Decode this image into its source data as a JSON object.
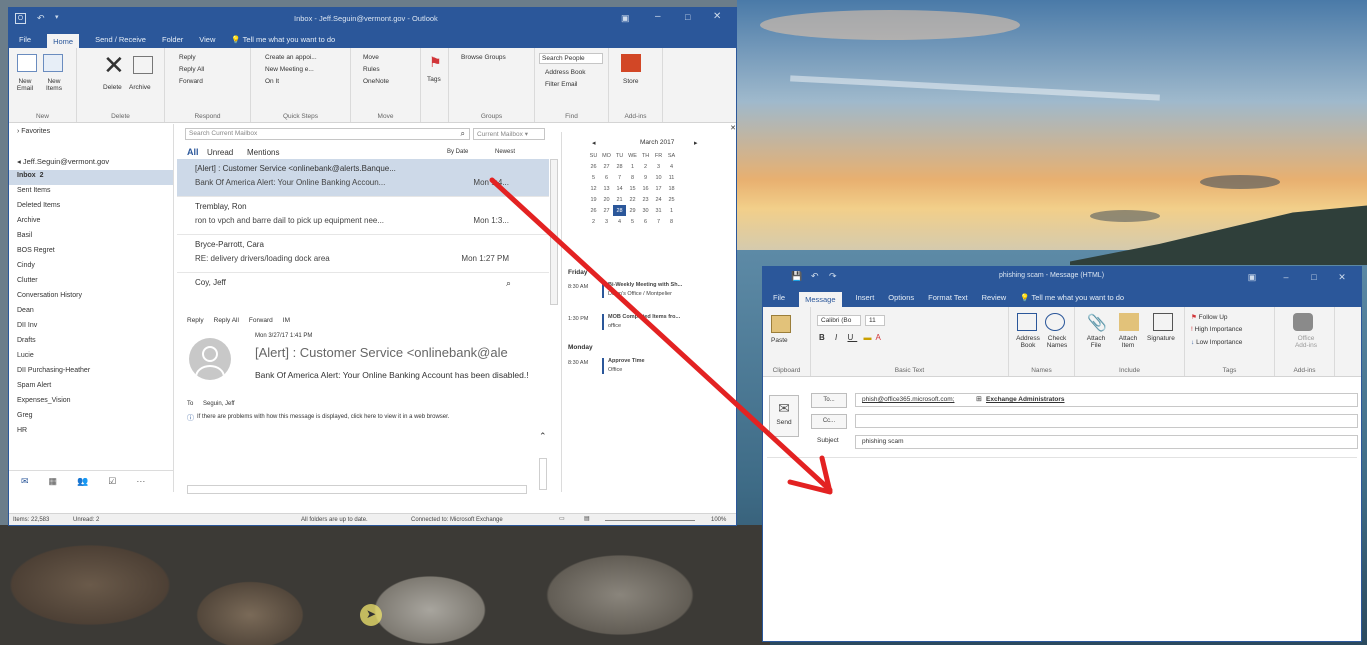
{
  "outlook": {
    "title": "Inbox - Jeff.Seguin@vermont.gov - Outlook",
    "tabs": [
      "File",
      "Home",
      "Send / Receive",
      "Folder",
      "View"
    ],
    "tell_me": "Tell me what you want to do",
    "ribbon": {
      "new_email": "New Email",
      "new_items": "New Items",
      "delete": "Delete",
      "archive": "Archive",
      "reply": "Reply",
      "reply_all": "Reply All",
      "forward": "Forward",
      "create_appt": "Create an appoi...",
      "new_meeting": "New Meeting e...",
      "on_it": "On It",
      "move": "Move",
      "rules": "Rules",
      "onenote": "OneNote",
      "tags": "Tags",
      "browse_groups": "Browse Groups",
      "search_people": "Search People",
      "address_book": "Address Book",
      "filter_email": "Filter Email",
      "store": "Store",
      "group_new": "New",
      "group_delete": "Delete",
      "group_respond": "Respond",
      "group_quicksteps": "Quick Steps",
      "group_move": "Move",
      "group_groups": "Groups",
      "group_find": "Find",
      "group_addins": "Add-ins"
    },
    "favorites": "Favorites",
    "account": "Jeff.Seguin@vermont.gov",
    "folders": [
      {
        "name": "Inbox",
        "count": "2"
      },
      {
        "name": "Sent Items"
      },
      {
        "name": "Deleted Items"
      },
      {
        "name": "Archive"
      },
      {
        "name": "Basil"
      },
      {
        "name": "BOS Regret"
      },
      {
        "name": "Cindy"
      },
      {
        "name": "Clutter"
      },
      {
        "name": "Conversation History"
      },
      {
        "name": "Dean"
      },
      {
        "name": "DII Inv"
      },
      {
        "name": "Drafts"
      },
      {
        "name": "Lucie"
      },
      {
        "name": "DII Purchasing-Heather"
      },
      {
        "name": "Spam Alert"
      },
      {
        "name": "Expenses_Vision"
      },
      {
        "name": "Greg"
      },
      {
        "name": "HR"
      }
    ],
    "search_placeholder": "Search Current Mailbox",
    "search_scope": "Current Mailbox",
    "filters": {
      "all": "All",
      "unread": "Unread",
      "mentions": "Mentions",
      "by_date": "By Date",
      "newest": "Newest"
    },
    "messages": [
      {
        "sender": "[Alert] : Customer Service <onlinebank@alerts.Banque...",
        "preview": "Bank Of America Alert: Your Online Banking Accoun...",
        "time": "Mon 1:4..."
      },
      {
        "sender": "Tremblay, Ron",
        "preview": "ron to vpch and barre dail to pick up equipment nee...",
        "time": "Mon 1:3..."
      },
      {
        "sender": "Bryce-Parrott, Cara",
        "preview": "RE: delivery drivers/loading dock area",
        "time": "Mon 1:27 PM"
      },
      {
        "sender": "Coy, Jeff",
        "preview": "",
        "time": ""
      }
    ],
    "reading": {
      "reply": "Reply",
      "reply_all": "Reply All",
      "forward": "Forward",
      "im": "IM",
      "date": "Mon 3/27/17 1:41 PM",
      "from": "[Alert] : Customer Service <onlinebank@ale",
      "subject": "Bank Of America Alert: Your Online Banking Account has been disabled.!",
      "to_label": "To",
      "to": "Seguin, Jeff",
      "info": "If there are problems with how this message is displayed, click here to view it in a web browser."
    },
    "calendar": {
      "month": "March 2017",
      "days": [
        "SU",
        "MO",
        "TU",
        "WE",
        "TH",
        "FR",
        "SA"
      ],
      "weeks": [
        [
          "26",
          "27",
          "28",
          "1",
          "2",
          "3",
          "4"
        ],
        [
          "5",
          "6",
          "7",
          "8",
          "9",
          "10",
          "11"
        ],
        [
          "12",
          "13",
          "14",
          "15",
          "16",
          "17",
          "18"
        ],
        [
          "19",
          "20",
          "21",
          "22",
          "23",
          "24",
          "25"
        ],
        [
          "26",
          "27",
          "28",
          "29",
          "30",
          "31",
          "1"
        ],
        [
          "2",
          "3",
          "4",
          "5",
          "6",
          "7",
          "8"
        ]
      ],
      "today": "28",
      "friday": "Friday",
      "events": [
        {
          "time": "8:30 AM",
          "title": "Bi-Weekly Meeting with Sh...",
          "loc": "Dawn's Office / Montpelier"
        },
        {
          "time": "1:30 PM",
          "title": "MOB Completed Items fro...",
          "loc": "office"
        }
      ],
      "monday": "Monday",
      "monday_events": [
        {
          "time": "8:30 AM",
          "title": "Approve Time",
          "loc": "Office"
        }
      ]
    },
    "status": {
      "items": "Items: 22,583",
      "unread": "Unread: 2",
      "sync": "All folders are up to date.",
      "conn": "Connected to: Microsoft Exchange",
      "zoom": "100%"
    }
  },
  "compose": {
    "title": "phishing scam - Message (HTML)",
    "tabs": [
      "File",
      "Message",
      "Insert",
      "Options",
      "Format Text",
      "Review"
    ],
    "tell_me": "Tell me what you want to do",
    "ribbon": {
      "paste": "Paste",
      "clipboard": "Clipboard",
      "font": "Calibri (Bo",
      "size": "11",
      "basic_text": "Basic Text",
      "address_book": "Address Book",
      "check_names": "Check Names",
      "names": "Names",
      "attach_file": "Attach File",
      "attach_item": "Attach Item",
      "signature": "Signature",
      "include": "Include",
      "follow_up": "Follow Up",
      "high": "High Importance",
      "low": "Low Importance",
      "tags": "Tags",
      "office_addins": "Office Add-ins",
      "addins": "Add-ins"
    },
    "send": "Send",
    "to_btn": "To...",
    "cc_btn": "Cc...",
    "subject_label": "Subject",
    "to_value": "phish@office365.microsoft.com; Exchange Administrators",
    "to_addr": "phish@office365.microsoft.com;",
    "to_group": "Exchange Administrators",
    "subject": "phishing scam"
  },
  "colors": {
    "accent": "#2b579a",
    "arrow": "#e32222",
    "today": "#2b579a"
  }
}
